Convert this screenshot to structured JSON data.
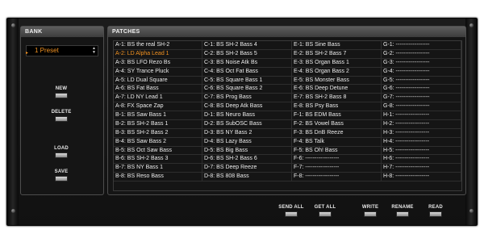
{
  "bank": {
    "title": "BANK",
    "preset_value": "1 Preset",
    "buttons": {
      "new": "NEW",
      "delete": "DELETE",
      "load": "LOAD",
      "save": "SAVE"
    }
  },
  "patches": {
    "title": "PATCHES",
    "columns": [
      [
        "A-1: BS the real SH-2",
        "A-2: LD Alpha Lead 1",
        "A-3: BS LFO Rezo Bs",
        "A-4: SY Trance Pluck",
        "A-5: LD Dual Square",
        "A-6: BS Fat Bass",
        "A-7: LD NY Lead 1",
        "A-8: FX Space Zap",
        "B-1: BS Saw Bass 1",
        "B-2: BS SH-2 Bass 1",
        "B-3: BS SH-2 Bass 2",
        "B-4: BS Saw Bass 2",
        "B-5: BS Oct Saw Bass",
        "B-6: BS SH-2 Bass 3",
        "B-7: BS NY Bass 1",
        "B-8: BS Reso Bass"
      ],
      [
        "C-1: BS SH-2 Bass 4",
        "C-2: BS SH-2 Bass 5",
        "C-3: BS Noise Atk Bs",
        "C-4: BS Oct Fat Bass",
        "C-5: BS Square Bass 1",
        "C-6: BS Square Bass 2",
        "C-7: BS Prog Bass",
        "C-8: BS Deep Atk Bass",
        "D-1: BS Neuro Bass",
        "D-2: BS SubOSC Bass",
        "D-3: BS NY Bass 2",
        "D-4: BS Lazy Bass",
        "D-5: BS Big Bass",
        "D-6: BS SH-2 Bass 6",
        "D-7: BS Deep Reeze",
        "D-8: BS 808 Bass"
      ],
      [
        "E-1: BS Sine Bass",
        "E-2: BS SH-2 Bass 7",
        "E-3: BS Organ Bass 1",
        "E-4: BS Organ Bass 2",
        "E-5: BS Monster Bass",
        "E-6: BS Deep Detune",
        "E-7: BS SH-2 Bass 8",
        "E-8: BS Psy Bass",
        "F-1: BS EDM Bass",
        "F-2: BS Vowel Bass",
        "F-3: BS DnB Reeze",
        "F-4: BS Talk",
        "F-5: BS Oh! Bass",
        "F-6: ------------------",
        "F-7: ------------------",
        "F-8: ------------------"
      ],
      [
        "G-1: ------------------",
        "G-2: ------------------",
        "G-3: ------------------",
        "G-4: ------------------",
        "G-5: ------------------",
        "G-6: ------------------",
        "G-7: ------------------",
        "G-8: ------------------",
        "H-1: ------------------",
        "H-2: ------------------",
        "H-3: ------------------",
        "H-4: ------------------",
        "H-5: ------------------",
        "H-6: ------------------",
        "H-7: ------------------",
        "H-8: ------------------"
      ]
    ],
    "selected": "A-2: LD Alpha Lead 1"
  },
  "footer": {
    "send_all": "SEND ALL",
    "get_all": "GET ALL",
    "write": "WRITE",
    "rename": "RENAME",
    "read": "READ"
  },
  "colors": {
    "accent": "#f29221",
    "background": "#141414",
    "text": "#ececec"
  }
}
